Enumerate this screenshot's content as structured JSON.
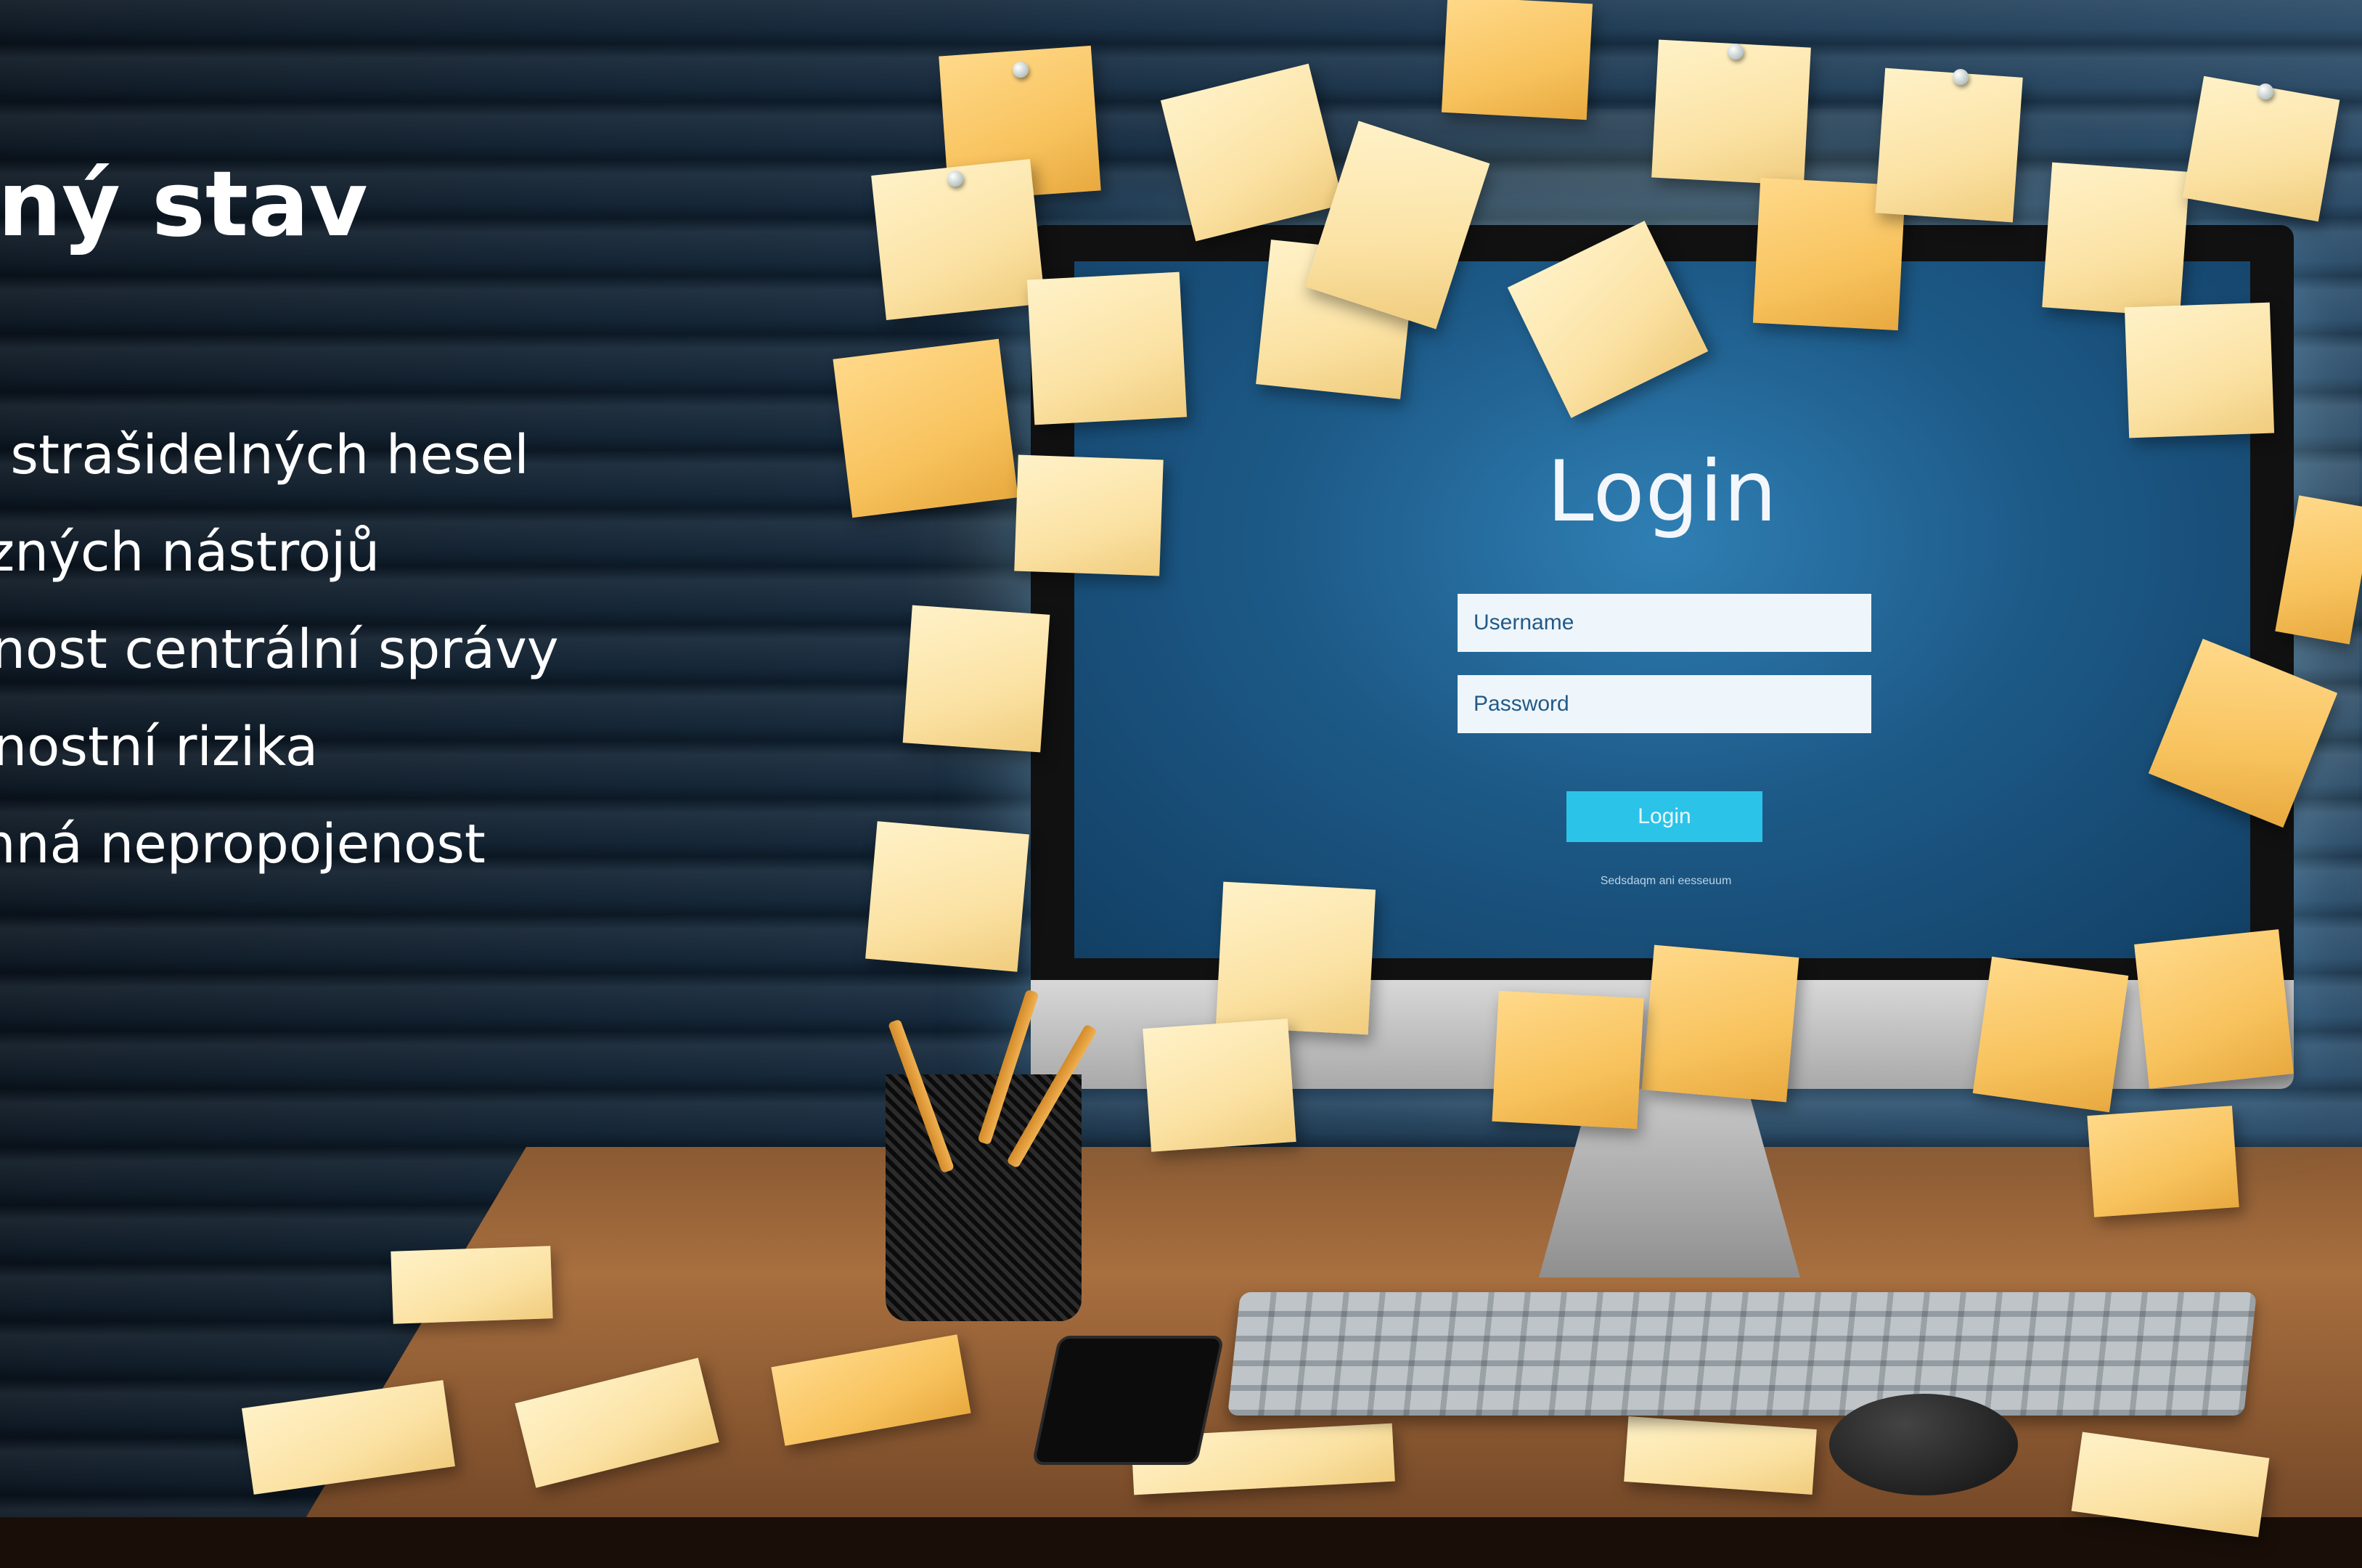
{
  "slide": {
    "title": "dný stav",
    "bullets": [
      "ka strašidelných hesel",
      "různých nástrojů",
      "ožnost centrální správy",
      "ečnostní rizika",
      "emná nepropojenost"
    ]
  },
  "login_screen": {
    "title": "Login",
    "username_placeholder": "Username",
    "password_placeholder": "Password",
    "button_label": "Login",
    "footnote": "Sedsdaqm ani eesseuum"
  },
  "colors": {
    "screen": "#1d5a88",
    "button": "#2cc3e8",
    "note": "#f8c35e",
    "text": "#ffffff"
  }
}
